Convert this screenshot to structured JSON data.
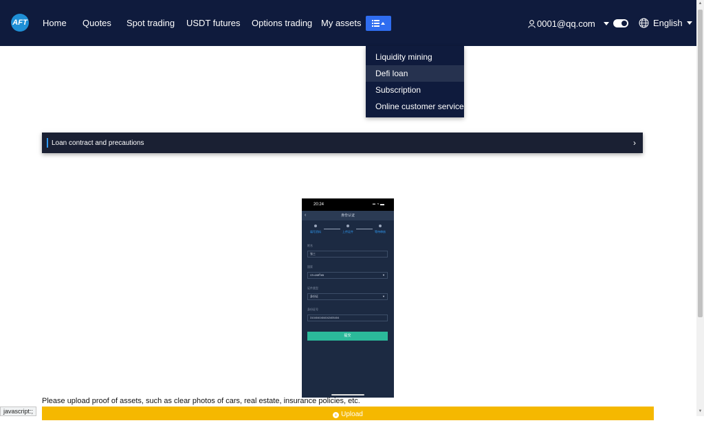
{
  "header": {
    "logo_text": "AFT",
    "nav": [
      "Home",
      "Quotes",
      "Spot trading",
      "USDT futures",
      "Options trading",
      "My assets"
    ],
    "user_email": "0001@qq.com",
    "language": "English"
  },
  "dropdown": {
    "items": [
      "Liquidity mining",
      "Defi loan",
      "Subscription",
      "Online customer service"
    ],
    "active_index": 1
  },
  "loan_bar": {
    "label": "Loan contract and precautions"
  },
  "phone": {
    "time": "20:24",
    "title": "身份认证",
    "steps": [
      "填写资料",
      "上传证件",
      "等待审核"
    ],
    "fields": [
      {
        "label": "姓名",
        "value": "张三"
      },
      {
        "label": "国家",
        "value": "ประเทศไทย"
      },
      {
        "label": "证件类型",
        "value": "身份证"
      },
      {
        "label": "身份证号",
        "value": "3104040404042405404"
      }
    ],
    "submit": "提交"
  },
  "main": {
    "note": "Please upload proof of assets, such as clear photos of cars, real estate, insurance policies, etc.",
    "upload_label": "Upload"
  },
  "status_tip": "javascript:;"
}
